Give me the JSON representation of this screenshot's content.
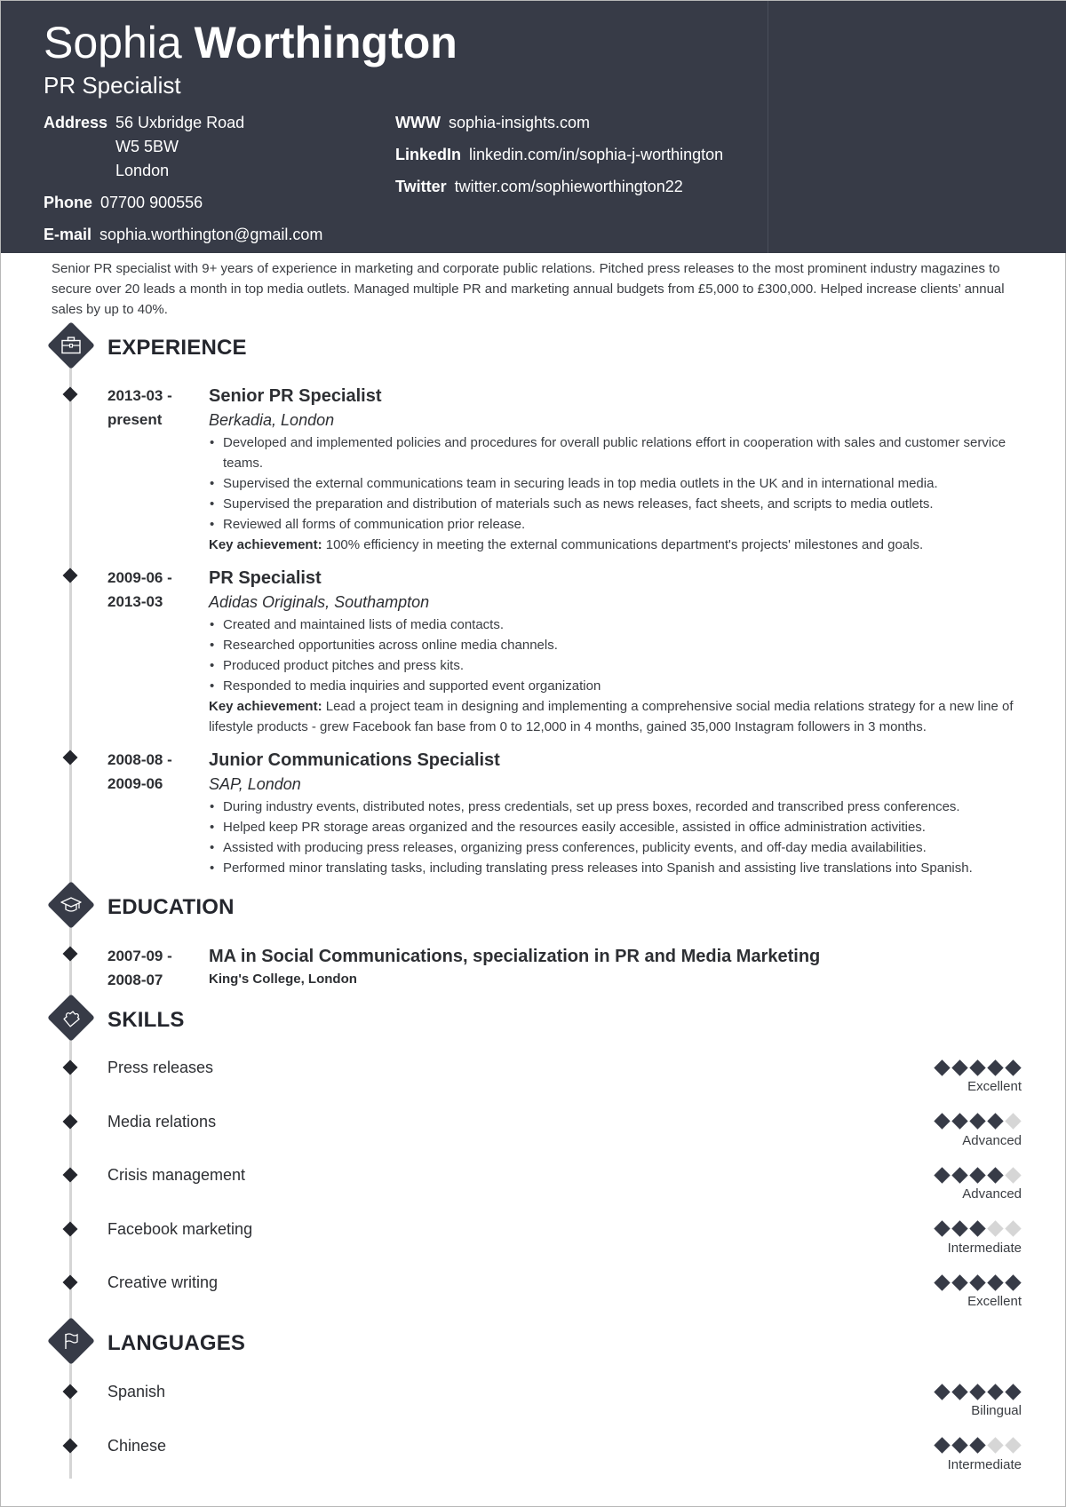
{
  "header": {
    "first_name": "Sophia",
    "last_name": "Worthington",
    "role": "PR Specialist",
    "contacts_left": [
      {
        "label": "Address",
        "lines": [
          "56 Uxbridge Road",
          "W5 5BW",
          "London"
        ]
      },
      {
        "label": "Phone",
        "value": "07700 900556"
      },
      {
        "label": "E-mail",
        "value": "sophia.worthington@gmail.com"
      }
    ],
    "contacts_right": [
      {
        "label": "WWW",
        "value": "sophia-insights.com"
      },
      {
        "label": "LinkedIn",
        "value": "linkedin.com/in/sophia-j-worthington"
      },
      {
        "label": "Twitter",
        "value": "twitter.com/sophieworthington22"
      }
    ]
  },
  "summary": "Senior PR specialist with 9+ years of experience in marketing and corporate public relations. Pitched press releases to the most prominent industry magazines to secure over 20 leads a month in top media outlets. Managed multiple PR and marketing annual budgets from £5,000 to £300,000. Helped increase clients’ annual sales by up to 40%.",
  "sections": {
    "experience": {
      "title": "EXPERIENCE",
      "icon": "briefcase-icon"
    },
    "education": {
      "title": "EDUCATION",
      "icon": "graduation-cap-icon"
    },
    "skills": {
      "title": "SKILLS",
      "icon": "puzzle-piece-icon"
    },
    "languages": {
      "title": "LANGUAGES",
      "icon": "flag-icon"
    }
  },
  "experience": [
    {
      "date_start": "2013-03 -",
      "date_end": "present",
      "title": "Senior PR Specialist",
      "company": "Berkadia, London",
      "bullets": [
        "Developed and implemented policies and procedures for overall public relations effort in cooperation with sales and customer service teams.",
        "Supervised the external communications team in securing leads in top media outlets in the UK and in international media.",
        "Supervised the preparation and distribution of materials such as news releases, fact sheets, and scripts to media outlets.",
        "Reviewed all forms of communication prior release."
      ],
      "key_label": "Key achievement:",
      "key_text": " 100% efficiency in meeting the external communications department's projects' milestones and goals."
    },
    {
      "date_start": "2009-06 -",
      "date_end": "2013-03",
      "title": "PR Specialist",
      "company": "Adidas Originals, Southampton",
      "bullets": [
        "Created and maintained lists of media contacts.",
        "Researched opportunities across online media channels.",
        "Produced product pitches and press kits.",
        "Responded to media inquiries and supported event organization"
      ],
      "key_label": "Key achievement:",
      "key_text": " Lead a project team in designing and implementing a comprehensive social media relations strategy for a new line of lifestyle products - grew Facebook fan base from 0 to 12,000 in 4 months, gained 35,000 Instagram followers in 3 months."
    },
    {
      "date_start": "2008-08 -",
      "date_end": "2009-06",
      "title": "Junior Communications Specialist",
      "company": "SAP, London",
      "bullets": [
        "During industry events, distributed notes, press credentials, set up press boxes, recorded and transcribed press conferences.",
        "Helped keep PR storage areas organized and the resources easily accesible, assisted in office administration activities.",
        "Assisted with producing press releases, organizing press conferences, publicity events, and off-day media availabilities.",
        "Performed minor translating tasks, including translating press releases into Spanish and assisting live translations into Spanish."
      ]
    }
  ],
  "education": [
    {
      "date_start": "2007-09 -",
      "date_end": "2008-07",
      "title": "MA in Social Communications, specialization in PR and Media Marketing",
      "school": "King's College, London"
    }
  ],
  "skills": [
    {
      "name": "Press releases",
      "rating": 5,
      "max": 5,
      "level": "Excellent"
    },
    {
      "name": "Media relations",
      "rating": 4,
      "max": 5,
      "level": "Advanced"
    },
    {
      "name": "Crisis management",
      "rating": 4,
      "max": 5,
      "level": "Advanced"
    },
    {
      "name": "Facebook marketing",
      "rating": 3,
      "max": 5,
      "level": "Intermediate"
    },
    {
      "name": "Creative writing",
      "rating": 5,
      "max": 5,
      "level": "Excellent"
    }
  ],
  "languages": [
    {
      "name": "Spanish",
      "rating": 5,
      "max": 5,
      "level": "Bilingual"
    },
    {
      "name": "Chinese",
      "rating": 3,
      "max": 5,
      "level": "Intermediate"
    }
  ],
  "colors": {
    "header_bg": "#373b47",
    "accent_dark": "#24262d",
    "pip_off": "#d6d6d6",
    "timeline": "#d5d5d5"
  }
}
